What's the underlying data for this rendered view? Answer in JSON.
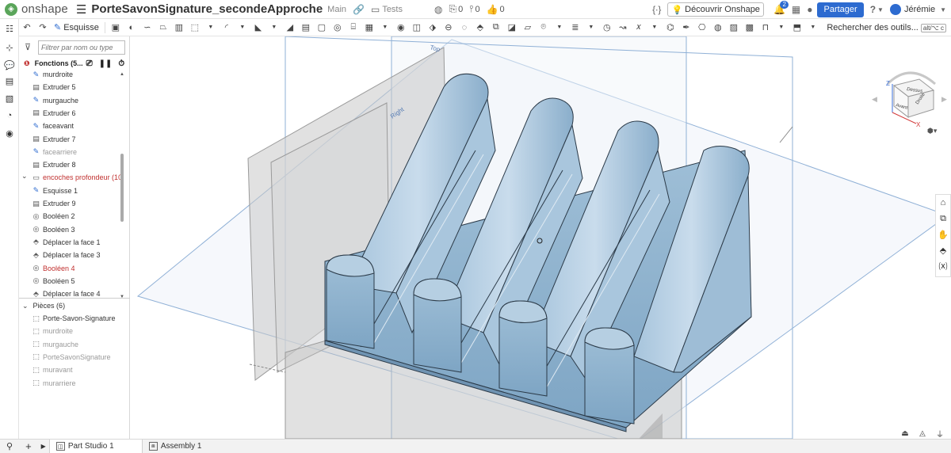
{
  "app": {
    "brand": "onshape",
    "doc_title": "PorteSavonSignature_secondeApproche",
    "branch": "Main",
    "folder": "Tests",
    "counts": {
      "doc": "0",
      "hist": "0",
      "like": "0"
    },
    "custom_features": "{∙}",
    "discover": "Découvrir Onshape",
    "notif_badge": "2",
    "share": "Partager",
    "help": "?",
    "user": "Jérémie"
  },
  "toolbar": {
    "sketch_label": "Esquisse",
    "search_tools": "Rechercher des outils...",
    "search_shortcut": "alt/⌥ c"
  },
  "panel": {
    "filter_placeholder": "Filtrer par nom ou type",
    "features_header": "Fonctions (5...",
    "features": [
      {
        "label": "murdroite",
        "icon": "sketch-icon",
        "state": "normal"
      },
      {
        "label": "Extruder 5",
        "icon": "extrude-icon",
        "state": "normal"
      },
      {
        "label": "murgauche",
        "icon": "sketch-icon",
        "state": "normal"
      },
      {
        "label": "Extruder 6",
        "icon": "extrude-icon",
        "state": "normal"
      },
      {
        "label": "faceavant",
        "icon": "sketch-icon",
        "state": "normal"
      },
      {
        "label": "Extruder 7",
        "icon": "extrude-icon",
        "state": "normal"
      },
      {
        "label": "facearriere",
        "icon": "sketch-icon",
        "state": "dim"
      },
      {
        "label": "Extruder 8",
        "icon": "extrude-icon",
        "state": "normal"
      },
      {
        "label": "encoches profondeur (10)",
        "icon": "folder-icon",
        "state": "red"
      },
      {
        "label": "Esquisse 1",
        "icon": "sketch-icon",
        "state": "normal"
      },
      {
        "label": "Extruder 9",
        "icon": "extrude-icon",
        "state": "normal"
      },
      {
        "label": "Booléen 2",
        "icon": "boolean-icon",
        "state": "normal"
      },
      {
        "label": "Booléen 3",
        "icon": "boolean-icon",
        "state": "normal"
      },
      {
        "label": "Déplacer la face 1",
        "icon": "move-face-icon",
        "state": "normal"
      },
      {
        "label": "Déplacer la face 3",
        "icon": "move-face-icon",
        "state": "normal"
      },
      {
        "label": "Booléen 4",
        "icon": "boolean-icon",
        "state": "red"
      },
      {
        "label": "Booléen 5",
        "icon": "boolean-icon",
        "state": "normal"
      },
      {
        "label": "Déplacer la face 4",
        "icon": "move-face-icon",
        "state": "normal"
      }
    ],
    "parts_header": "Pièces (6)",
    "parts": [
      {
        "label": "Porte-Savon-Signature",
        "state": "normal"
      },
      {
        "label": "murdroite",
        "state": "dim"
      },
      {
        "label": "murgauche",
        "state": "dim"
      },
      {
        "label": "PorteSavonSignature",
        "state": "dim"
      },
      {
        "label": "muravant",
        "state": "dim"
      },
      {
        "label": "murarriere",
        "state": "dim"
      }
    ]
  },
  "viewport": {
    "plane_top": "Top",
    "plane_right": "Right",
    "viewcube": {
      "top": "Dessus",
      "front": "Avant",
      "right": "Droite",
      "axis_z": "Z",
      "axis_x": "X"
    }
  },
  "tabs": [
    {
      "label": "Part Studio 1",
      "active": true
    },
    {
      "label": "Assembly 1",
      "active": false
    }
  ],
  "colors": {
    "accent": "#2d6bd0",
    "part": "#9dc0d9",
    "error": "#c0302f"
  }
}
